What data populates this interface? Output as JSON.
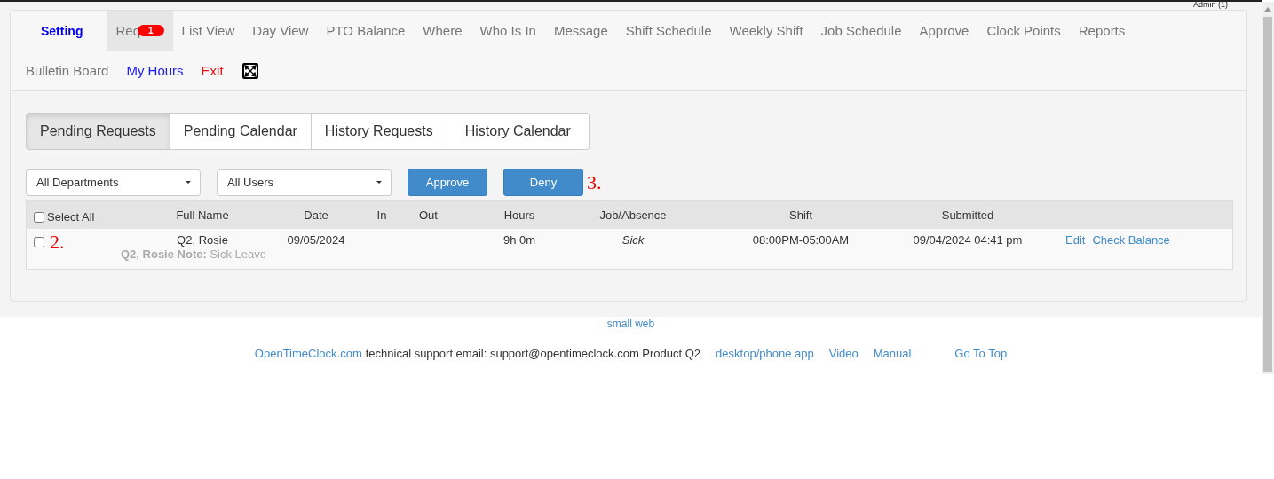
{
  "account": {
    "label": "Admin (1)"
  },
  "nav": [
    {
      "label": "Setting",
      "kind": "primary",
      "selected": false
    },
    {
      "label": "Req",
      "kind": "plain",
      "selected": true,
      "badge": "1"
    },
    {
      "label": "List View",
      "kind": "plain",
      "selected": false
    },
    {
      "label": "Day View",
      "kind": "plain",
      "selected": false
    },
    {
      "label": "PTO Balance",
      "kind": "plain",
      "selected": false
    },
    {
      "label": "Where",
      "kind": "plain",
      "selected": false
    },
    {
      "label": "Who Is In",
      "kind": "plain",
      "selected": false
    },
    {
      "label": "Message",
      "kind": "plain",
      "selected": false
    },
    {
      "label": "Shift Schedule",
      "kind": "plain",
      "selected": false
    },
    {
      "label": "Weekly Shift",
      "kind": "plain",
      "selected": false
    },
    {
      "label": "Job Schedule",
      "kind": "plain",
      "selected": false
    },
    {
      "label": "Approve",
      "kind": "plain",
      "selected": false
    },
    {
      "label": "Clock Points",
      "kind": "plain",
      "selected": false
    },
    {
      "label": "Reports",
      "kind": "plain",
      "selected": false
    },
    {
      "label": "Bulletin Board",
      "kind": "plain",
      "selected": false
    },
    {
      "label": "My Hours",
      "kind": "link",
      "selected": false
    },
    {
      "label": "Exit",
      "kind": "danger",
      "selected": false
    },
    {
      "kind": "fullscreen",
      "selected": false
    }
  ],
  "tabs": [
    {
      "label": "Pending Requests",
      "selected": true
    },
    {
      "label": "Pending Calendar",
      "selected": false
    },
    {
      "label": "History Requests",
      "selected": false
    },
    {
      "label": "History Calendar",
      "selected": false
    }
  ],
  "filters": [
    {
      "value": "All Departments"
    },
    {
      "value": "All Users"
    }
  ],
  "buttons": [
    "Approve",
    "Deny"
  ],
  "annotations": [
    "3.",
    "2."
  ],
  "table": {
    "select_all": {
      "label": "Select All",
      "checked": false
    },
    "columns": [
      "Full Name",
      "Date",
      "In",
      "Out",
      "Hours",
      "Job/Absence",
      "Shift",
      "Submitted"
    ],
    "rows": [
      {
        "checked": false,
        "full_name": "Q2, Rosie",
        "date": "09/05/2024",
        "in_time": "",
        "out_time": "",
        "hours": "9h 0m",
        "job_absence": "Sick",
        "shift": "08:00PM-05:00AM",
        "submitted": "09/04/2024 04:41 pm",
        "actions": [
          "Edit",
          "Check Balance"
        ],
        "note": "**Q2, Rosie Note:** Sick Leave"
      }
    ]
  },
  "footer": {
    "top_link": "small web",
    "links_before": [
      "OpenTimeClock.com"
    ],
    "text": "technical support email: support@opentimeclock.com Product Q2",
    "links_after": [
      "desktop/phone app",
      "Video",
      "Manual"
    ],
    "go_top": "Go To Top"
  }
}
